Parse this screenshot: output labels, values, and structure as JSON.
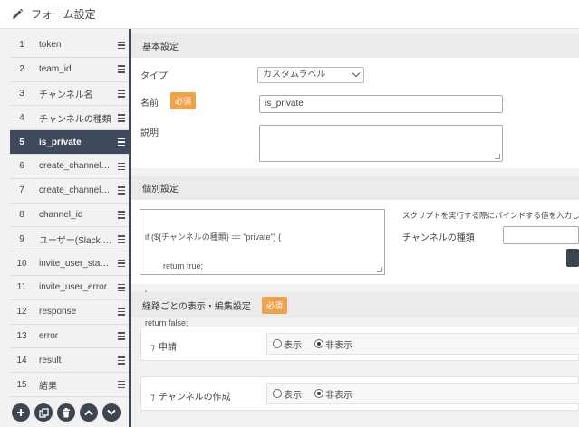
{
  "header": {
    "title": "フォーム設定",
    "icon": "pencil-icon"
  },
  "fields": [
    {
      "num": "1",
      "name": "token"
    },
    {
      "num": "2",
      "name": "team_id"
    },
    {
      "num": "3",
      "name": "チャンネル名"
    },
    {
      "num": "4",
      "name": "チャンネルの種類"
    },
    {
      "num": "5",
      "name": "is_private",
      "active": true
    },
    {
      "num": "6",
      "name": "create_channel…"
    },
    {
      "num": "7",
      "name": "create_channel…"
    },
    {
      "num": "8",
      "name": "channel_id"
    },
    {
      "num": "9",
      "name": "ユーザー(Slack U…"
    },
    {
      "num": "10",
      "name": "invite_user_sta…"
    },
    {
      "num": "11",
      "name": "invite_user_error"
    },
    {
      "num": "12",
      "name": "response"
    },
    {
      "num": "13",
      "name": "error"
    },
    {
      "num": "14",
      "name": "result"
    },
    {
      "num": "15",
      "name": "結果"
    }
  ],
  "tools": [
    "plus-icon",
    "copy-icon",
    "trash-icon",
    "chevron-up-icon",
    "chevron-down-icon"
  ],
  "basic": {
    "heading": "基本設定",
    "type_label": "タイプ",
    "type_value": "カスタムラベル",
    "name_label": "名前",
    "required_badge": "必須",
    "name_value": "is_private",
    "desc_label": "説明",
    "desc_value": ""
  },
  "individual": {
    "heading": "個別設定",
    "script_lines": [
      "if (${チャンネルの種類} == \"private\") {",
      "        return true;",
      "}",
      "return false;"
    ],
    "hint": "スクリプトを実行する際にバインドする値を入力してく",
    "bind_label": "チャンネルの種類",
    "bind_value": ""
  },
  "route": {
    "heading": "経路ごとの表示・編集設定",
    "required_badge": "必須",
    "show_label": "表示",
    "hide_label": "非表示",
    "items": [
      {
        "name": "申請",
        "selected": "hide"
      },
      {
        "name": "チャンネルの作成",
        "selected": "hide"
      }
    ]
  },
  "colors": {
    "active_row": "#3d4a5c",
    "badge": "#f0a24b",
    "tool_button": "#3d4550"
  }
}
